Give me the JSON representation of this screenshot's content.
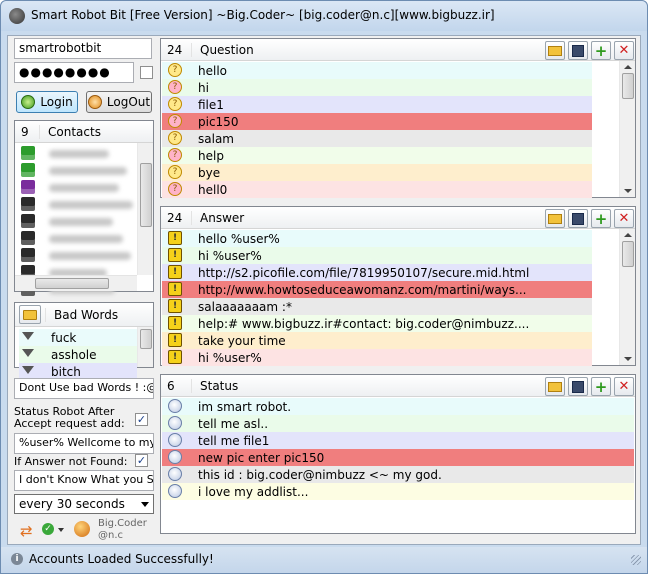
{
  "window": {
    "title": "Smart Robot Bit [Free Version] ~Big.Coder~ [big.coder@n.c][www.bigbuzz.ir]"
  },
  "login": {
    "username": "smartrobotbit",
    "password": "●●●●●●●●",
    "login_label": "Login",
    "logout_label": "LogOut"
  },
  "contacts": {
    "count": "9",
    "title": "Contacts",
    "icon_colors": [
      "#2c9c2c",
      "#2c9c2c",
      "#7a2c9c",
      "#2a2a2a",
      "#2a2a2a",
      "#2a2a2a",
      "#2a2a2a",
      "#2a2a2a",
      "#2a2a2a"
    ]
  },
  "bad_words": {
    "title": "Bad Words",
    "items": [
      "fuck",
      "asshole",
      "bitch"
    ],
    "warning_text": "Dont Use bad Words ! :@ ..."
  },
  "settings": {
    "status_after_accept_label_1": "Status Robot After",
    "status_after_accept_label_2": "Accept request add:",
    "welcome_text": "%user% Wellcome to my addlist",
    "no_answer_label": "If Answer not Found:",
    "no_answer_text": "I don't Know What you Say.",
    "interval": "every 30 seconds",
    "credit": "Big.Coder\n@n.c"
  },
  "questions": {
    "count": "24",
    "title": "Question",
    "items": [
      "hello",
      "hi",
      "file1",
      "pic150",
      "salam",
      "help",
      "bye",
      "hell0"
    ]
  },
  "answers": {
    "count": "24",
    "title": "Answer",
    "items": [
      "hello %user%",
      "hi %user%",
      "http://s2.picofile.com/file/7819950107/secure.mid.html",
      "http://www.howtoseduceawomanz.com/martini/ways...",
      "salaaaaaaam :*",
      "help:# www.bigbuzz.ir#contact: big.coder@nimbuzz....",
      "take your time",
      "hi %user%"
    ]
  },
  "statuses": {
    "count": "6",
    "title": "Status",
    "items": [
      "im smart robot.",
      "tell me asl..",
      "tell me file1",
      "new pic enter pic150",
      "this id : big.coder@nimbuzz <~ my god.",
      "i love my addlist..."
    ]
  },
  "row_colors": [
    "#e8fbfb",
    "#eafbea",
    "#e3e4fb",
    "#f07e7e",
    "#e9e9e9",
    "#f1fdea",
    "#feeecd",
    "#fde3e3"
  ],
  "status_row_colors": [
    "#e8fbfb",
    "#eafbea",
    "#e3e4fb",
    "#f07e7e",
    "#e9e9e9",
    "#fdfde3"
  ],
  "statusbar": {
    "message": "Accounts Loaded Successfully!"
  }
}
